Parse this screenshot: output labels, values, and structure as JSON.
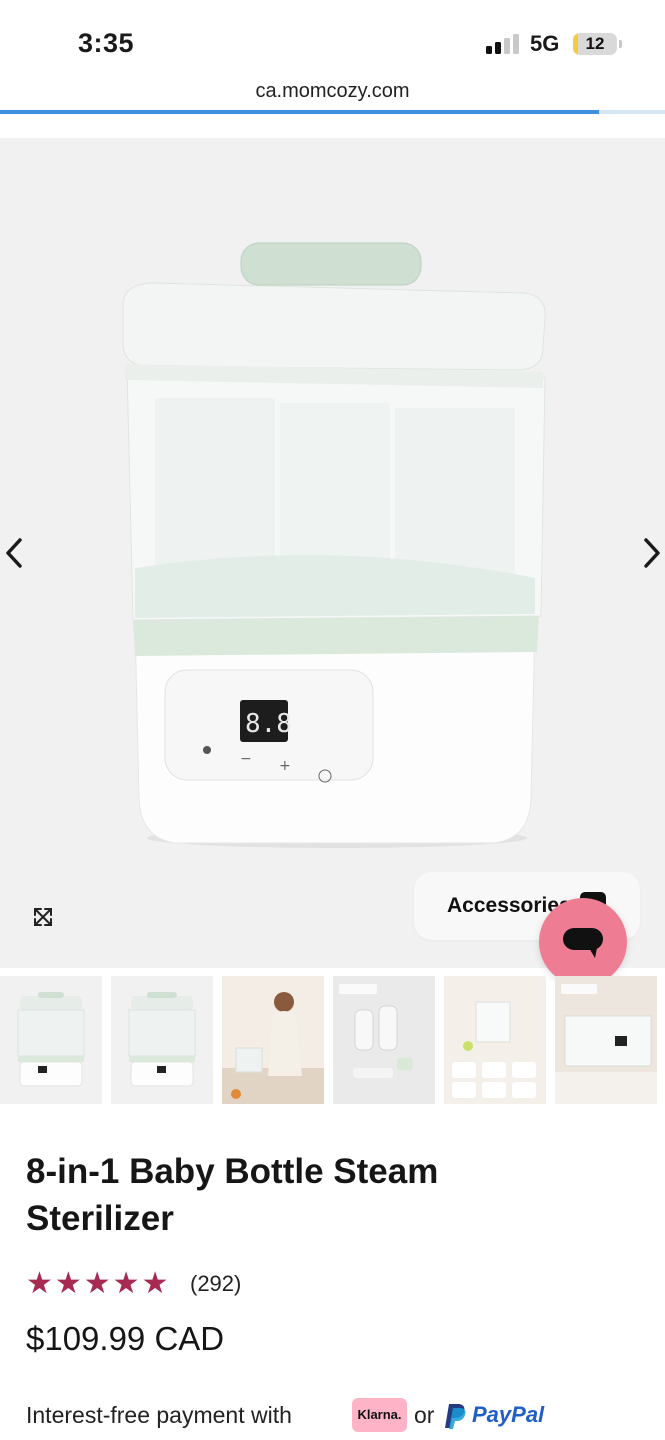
{
  "status_bar": {
    "time": "3:35",
    "network": "5G",
    "battery_percent": "12",
    "battery_fraction": 0.12,
    "battery_color": "#f3cc3f"
  },
  "browser": {
    "url": "ca.momcozy.com",
    "load_progress": 0.9,
    "progress_color": "#3f8de0"
  },
  "gallery": {
    "main_image_icon": "baby-bottle-sterilizer-product-image",
    "display_digits": "8.8",
    "prev_icon": "chevron-left-icon",
    "next_icon": "chevron-right-icon",
    "expand_icon": "expand-icon",
    "accessories_label": "Accessories",
    "chat_icon": "chat-bubble-icon",
    "chat_color": "#ee7d93",
    "thumbnails": [
      {
        "name": "thumbnail-front-view"
      },
      {
        "name": "thumbnail-side-view"
      },
      {
        "name": "thumbnail-lifestyle-woman"
      },
      {
        "name": "thumbnail-large-capacity"
      },
      {
        "name": "thumbnail-functions"
      },
      {
        "name": "thumbnail-control-panel"
      }
    ]
  },
  "product": {
    "title": "8-in-1 Baby Bottle Steam Sterilizer",
    "stars": "★★★★★",
    "rating": 5,
    "review_count": "(292)",
    "price": "$109.99 CAD",
    "star_color": "#a62a52"
  },
  "payment": {
    "text": "Interest-free payment with",
    "klarna_label": "Klarna.",
    "or_text": "or",
    "paypal_label": "PayPal",
    "klarna_color": "#ffb3c7",
    "paypal_color": "#1f5fc7"
  }
}
